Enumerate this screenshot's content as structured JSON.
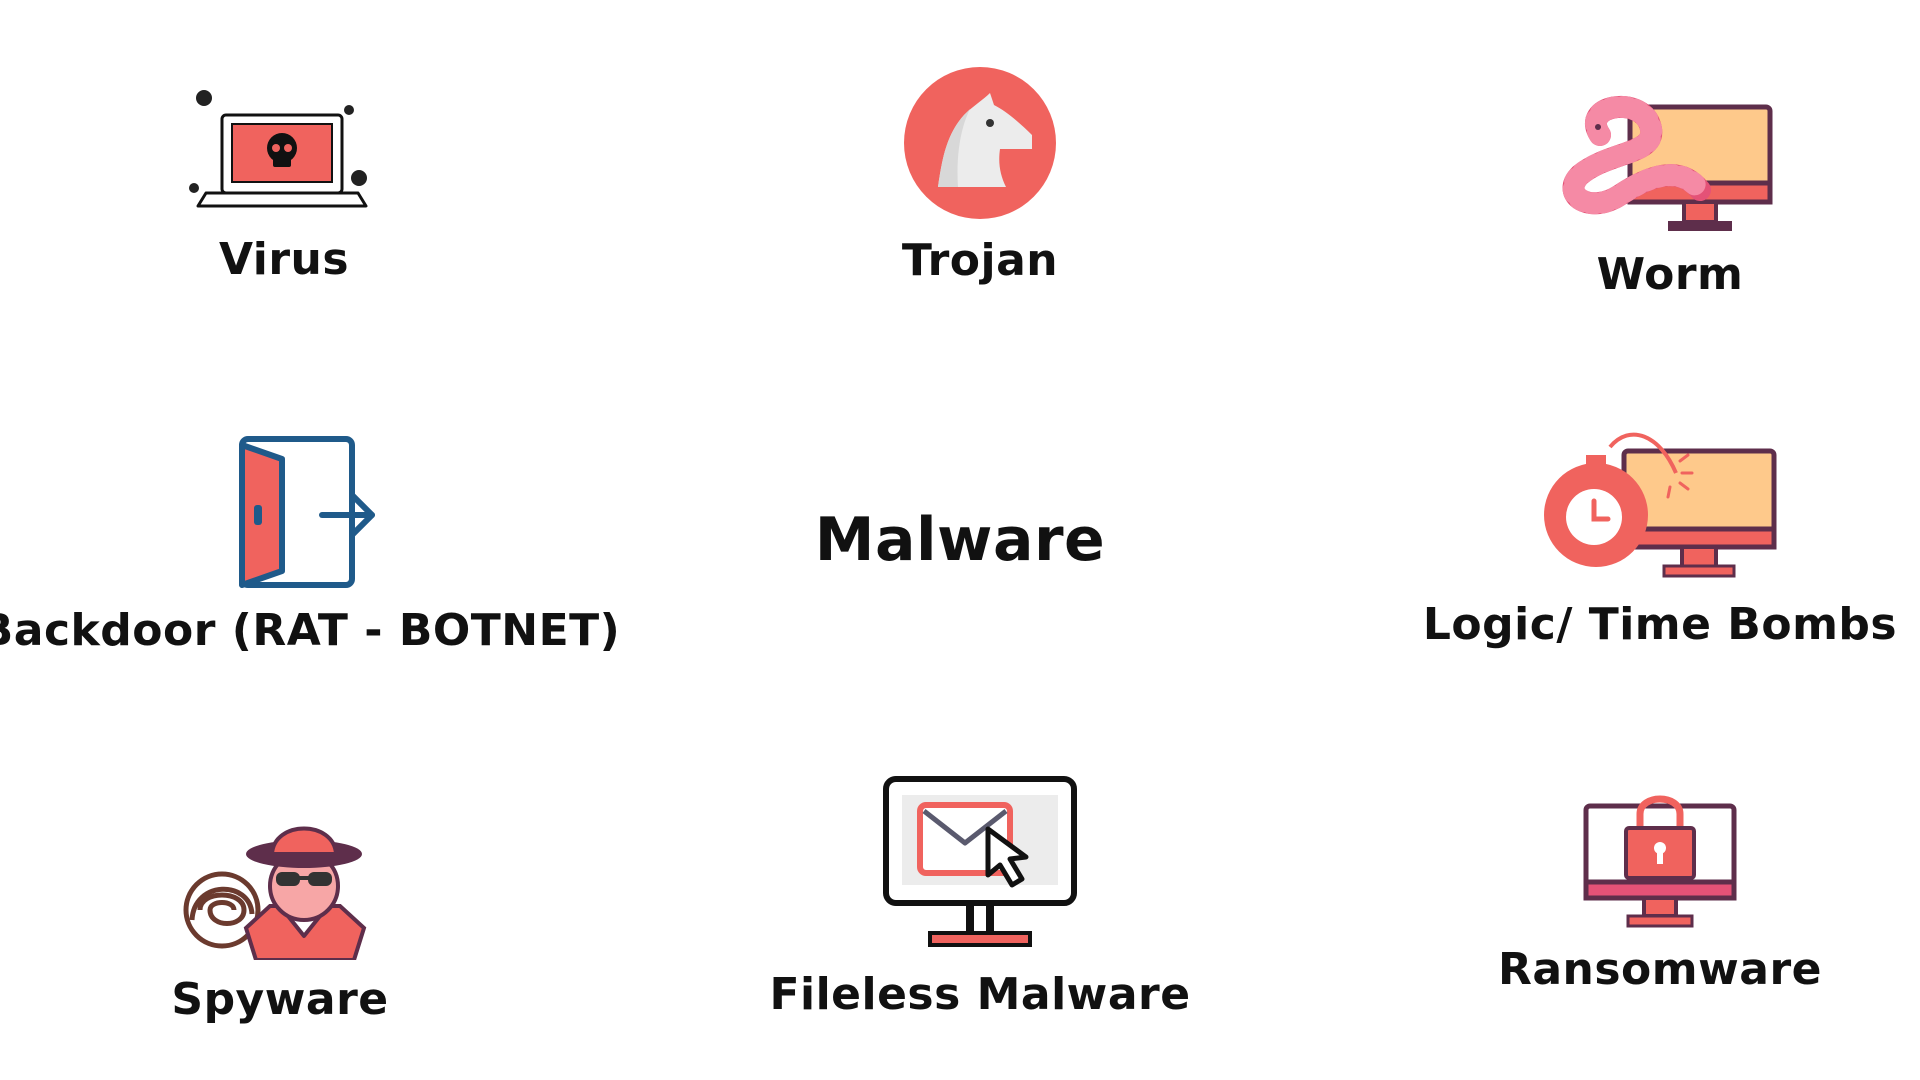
{
  "title": "Malware",
  "items": [
    {
      "label": "Virus",
      "icon": "virus-laptop-icon"
    },
    {
      "label": "Trojan",
      "icon": "trojan-horse-icon"
    },
    {
      "label": "Worm",
      "icon": "worm-monitor-icon"
    },
    {
      "label": "Backdoor (RAT - BOTNET)",
      "icon": "backdoor-icon"
    },
    {
      "label": "Logic/ Time Bombs",
      "icon": "time-bomb-icon"
    },
    {
      "label": "Spyware",
      "icon": "spyware-icon"
    },
    {
      "label": "Fileless Malware",
      "icon": "fileless-email-icon"
    },
    {
      "label": "Ransomware",
      "icon": "ransomware-lock-icon"
    }
  ],
  "colors": {
    "coral": "#f0635e",
    "peach": "#fec98b",
    "plum": "#5e2e4b",
    "navy": "#1f5a8a",
    "pink": "#e45277",
    "text": "#111111"
  }
}
